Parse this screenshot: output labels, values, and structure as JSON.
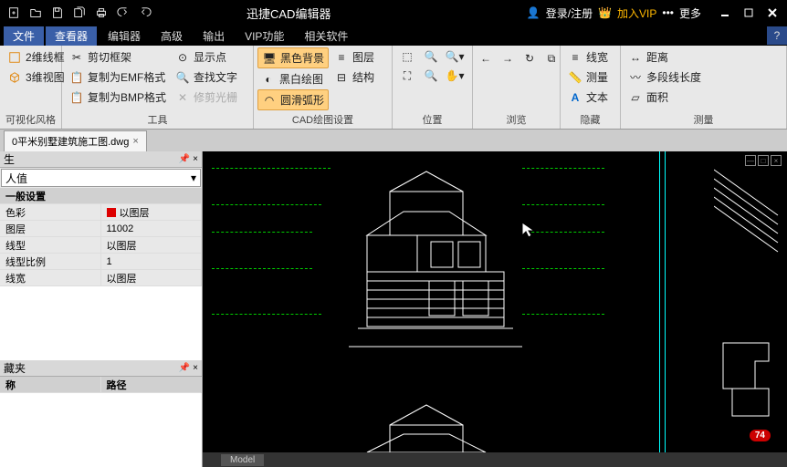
{
  "title": "迅捷CAD编辑器",
  "titlebar_right": {
    "login": "登录/注册",
    "vip": "加入VIP",
    "more": "更多"
  },
  "menu": {
    "items": [
      "文件",
      "查看器",
      "编辑器",
      "高级",
      "输出",
      "VIP功能",
      "相关软件"
    ],
    "active_index": 1
  },
  "ribbon": {
    "groups": [
      {
        "label": "可视化风格",
        "cols": [
          [
            "2维线框",
            "3维视图"
          ]
        ]
      },
      {
        "label": "工具",
        "cols": [
          [
            "剪切框架",
            "复制为EMF格式",
            "复制为BMP格式"
          ],
          [
            "显示点",
            "查找文字",
            "修剪光栅"
          ]
        ]
      },
      {
        "label": "CAD绘图设置",
        "cols": [
          [
            "黑色背景",
            "黑白绘图",
            "圆滑弧形"
          ],
          [
            "图层",
            "结构"
          ]
        ],
        "hl": [
          0,
          2
        ]
      },
      {
        "label": "位置",
        "cols": [
          [
            "",
            "",
            ""
          ],
          [
            "",
            "",
            ""
          ],
          [
            "",
            "",
            ""
          ]
        ],
        "icons_only": true
      },
      {
        "label": "浏览",
        "cols": [
          [
            "",
            "",
            "",
            ""
          ]
        ],
        "icons_only": true,
        "horiz": true
      },
      {
        "label": "隐藏",
        "cols": [
          [
            "线宽",
            "测量",
            "文本"
          ]
        ]
      },
      {
        "label": "测量",
        "cols": [
          [
            "距离",
            "多段线长度",
            "面积"
          ]
        ]
      }
    ]
  },
  "tab": {
    "name": "0平米别墅建筑施工图.dwg"
  },
  "sidebar": {
    "hdr1": "生",
    "combo": "人值",
    "section": "一般设置",
    "rows": [
      {
        "k": "色彩",
        "v": "以图层",
        "color": true
      },
      {
        "k": "图层",
        "v": "11002"
      },
      {
        "k": "线型",
        "v": "以图层"
      },
      {
        "k": "线型比例",
        "v": "1"
      },
      {
        "k": "线宽",
        "v": "以图层"
      }
    ],
    "hdr2": "藏夹",
    "cols": [
      "称",
      "路径"
    ]
  },
  "status": {
    "model": "Model"
  },
  "badge": "74"
}
